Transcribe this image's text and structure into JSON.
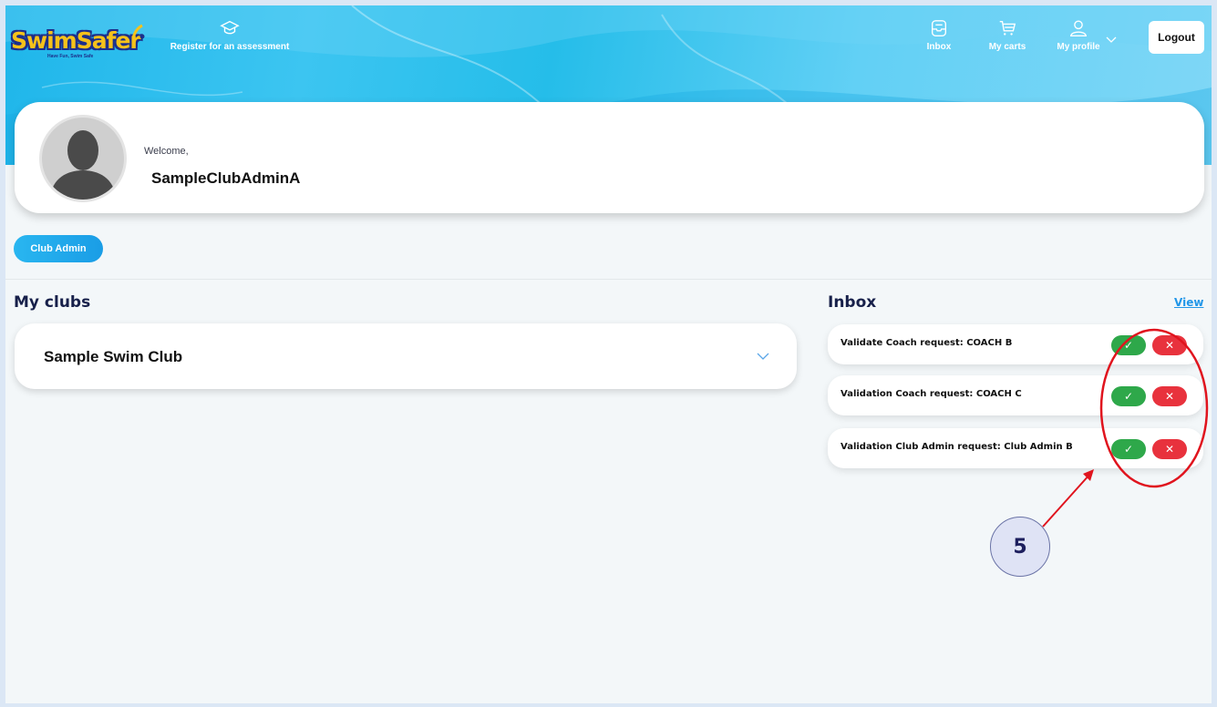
{
  "header": {
    "logo_text": "SwimSafer",
    "logo_tagline": "Have Fun, Swim Safe",
    "register_label": "Register for an assessment",
    "inbox_label": "Inbox",
    "carts_label": "My carts",
    "profile_label": "My profile",
    "logout_label": "Logout"
  },
  "profile": {
    "welcome": "Welcome,",
    "username": "SampleClubAdminA",
    "role": "Club Admin"
  },
  "clubs": {
    "title": "My clubs",
    "items": [
      {
        "name": "Sample Swim Club"
      }
    ]
  },
  "inbox": {
    "title": "Inbox",
    "view_label": "View",
    "items": [
      {
        "text": "Validate Coach request: COACH B"
      },
      {
        "text": "Validation Coach request: COACH C"
      },
      {
        "text": "Validation Club Admin request: Club Admin B"
      }
    ],
    "accept_symbol": "✓",
    "reject_symbol": "✕"
  },
  "annotation": {
    "step_number": "5",
    "color": "#e0141e"
  },
  "colors": {
    "accept": "#2ea84a",
    "reject": "#e8323d",
    "accent": "#29b6f0",
    "heading": "#17204a"
  }
}
